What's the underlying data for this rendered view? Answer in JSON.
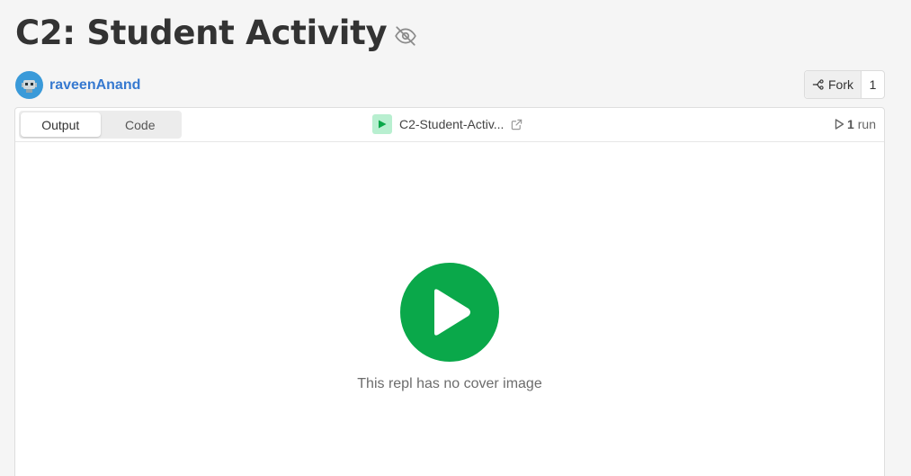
{
  "page": {
    "title": "C2: Student Activity",
    "visibility_icon": "eye-off-icon"
  },
  "author": {
    "name": "raveenAnand",
    "avatar_icon": "robot-avatar"
  },
  "fork": {
    "label": "Fork",
    "count": "1",
    "icon": "fork-icon"
  },
  "panel": {
    "tabs": [
      {
        "label": "Output",
        "active": true
      },
      {
        "label": "Code",
        "active": false
      }
    ],
    "repl_name": "C2-Student-Activ...",
    "lang_icon": "play-icon",
    "external_icon": "external-link-icon",
    "runs": {
      "icon": "play-outline-icon",
      "count": "1",
      "label": "run"
    },
    "cover_text": "This repl has no cover image"
  },
  "colors": {
    "accent_link": "#3679d0",
    "run_green": "#0aa84a",
    "lang_icon_bg": "#b8efd0"
  }
}
